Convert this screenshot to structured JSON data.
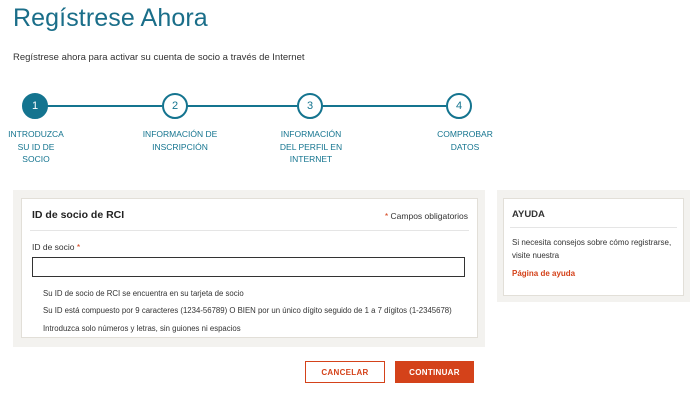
{
  "header": {
    "title": "Regístrese Ahora",
    "subtitle": "Regístrese ahora para activar su cuenta de socio a través de Internet"
  },
  "stepper": {
    "current_step": 1,
    "steps": [
      {
        "number": "1",
        "label": "INTRODUZCA SU ID DE SOCIO"
      },
      {
        "number": "2",
        "label": "INFORMACIÓN DE INSCRIPCIÓN"
      },
      {
        "number": "3",
        "label": "INFORMACIÓN DEL PERFIL EN INTERNET"
      },
      {
        "number": "4",
        "label": "COMPROBAR DATOS"
      }
    ]
  },
  "form": {
    "title": "ID de socio de RCI",
    "required_star": "*",
    "required_note": "Campos obligatorios",
    "field_label": "ID de socio",
    "field_value": "",
    "field_placeholder": "",
    "hints": [
      "Su ID de socio de RCI se encuentra en su tarjeta de socio",
      "Su ID está compuesto por 9 caracteres (1234-56789) O BIEN por un único dígito seguido de 1 a 7 dígitos (1-2345678)",
      "Introduzca solo números y letras, sin guiones ni espacios"
    ]
  },
  "help": {
    "title": "AYUDA",
    "text": "Si necesita consejos sobre cómo registrarse, visite nuestra",
    "link": "Página de ayuda"
  },
  "actions": {
    "cancel_label": "CANCELAR",
    "continue_label": "CONTINUAR"
  },
  "colors": {
    "accent": "#14748f",
    "brand_orange": "#d4421a",
    "panel_bg": "#f3f2ef"
  }
}
